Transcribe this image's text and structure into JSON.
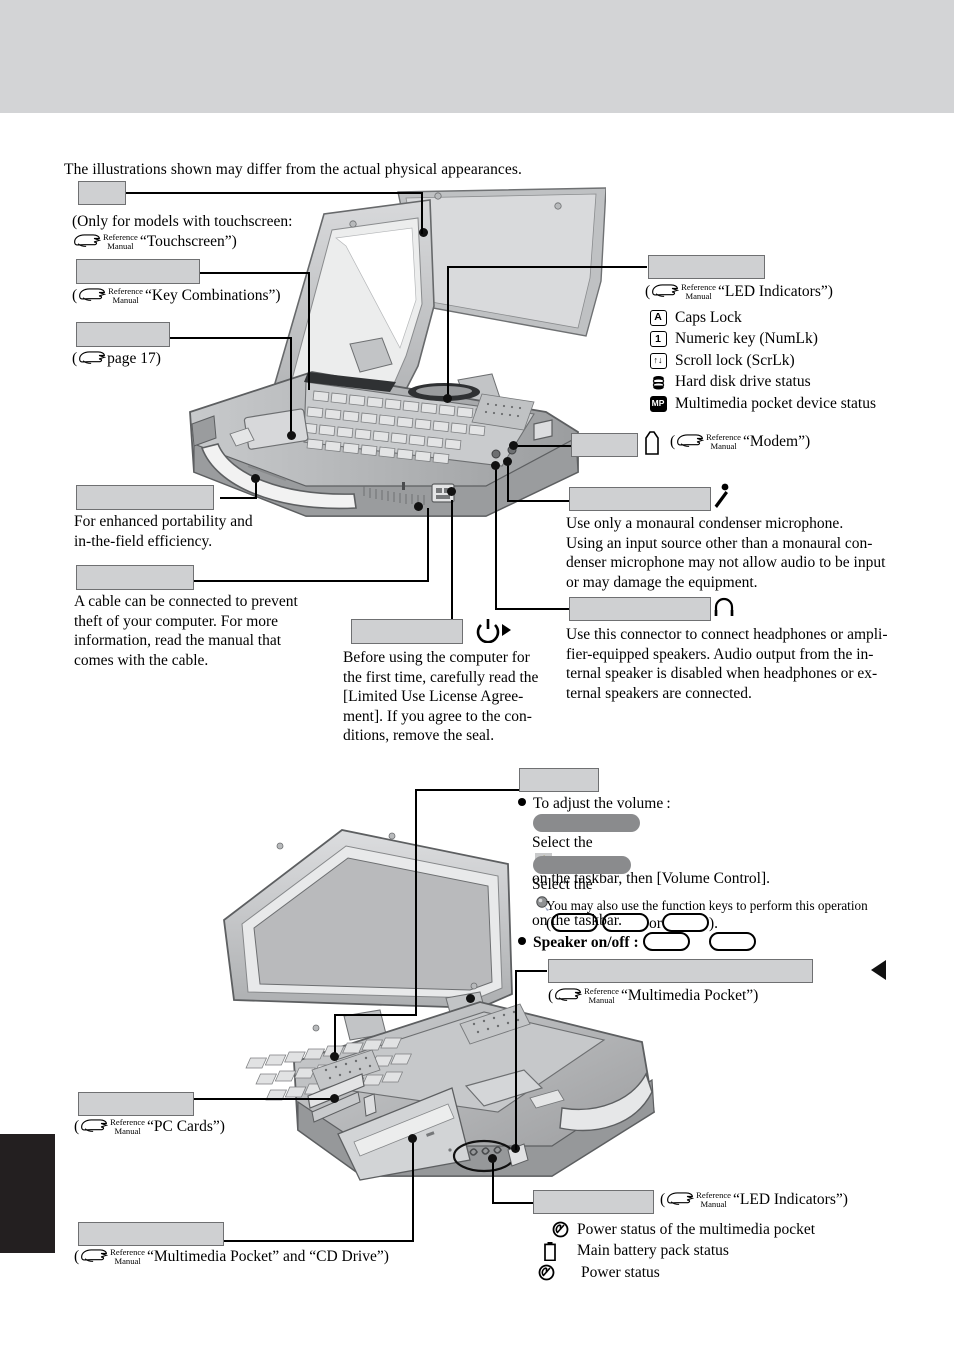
{
  "page": {
    "intro": "The illustrations shown may differ from the actual physical appearances.",
    "reference_manual": {
      "line1": "Reference",
      "line2": "Manual"
    }
  },
  "top_figure": {
    "labels": {
      "touchscreen": {
        "redacted": true,
        "note_line1": "(Only for models with touchscreen:",
        "ref_open": "",
        "ref_target": "“Touchscreen”)"
      },
      "keyboard": {
        "redacted": true,
        "ref_prefix": "(",
        "ref_target": "“Key Combinations”)"
      },
      "touchpad": {
        "redacted": true,
        "ref_prefix": "(",
        "ref_target": "page 17)"
      },
      "handle": {
        "redacted": true,
        "body_line1": "For enhanced portability and",
        "body_line2": "in-the-field efficiency."
      },
      "security_lock": {
        "redacted": true,
        "body_line1": "A cable can be connected to prevent",
        "body_line2": "theft of your computer.  For more",
        "body_line3": "information, read the manual that",
        "body_line4": "comes with the cable."
      },
      "power_switch": {
        "redacted": true,
        "icon": "power-symbol",
        "body_line1": "Before using the computer for",
        "body_line2": "the first time, carefully read the",
        "body_line3": "[Limited Use License Agree-",
        "body_line4": "ment].  If you agree to the con-",
        "body_line5": "ditions, remove the seal."
      },
      "led_indicators": {
        "redacted": true,
        "ref_prefix": "(",
        "ref_target": "“LED Indicators”)",
        "items": [
          {
            "icon": "A",
            "icon_kind": "boxed-letter",
            "label": "Caps Lock"
          },
          {
            "icon": "1",
            "icon_kind": "boxed-letter",
            "label": "Numeric key (NumLk)"
          },
          {
            "icon": "↑↓",
            "icon_kind": "boxed-letter",
            "label": "Scroll lock (ScrLk)"
          },
          {
            "icon": "disk-stack",
            "icon_kind": "glyph",
            "label": "Hard disk drive status"
          },
          {
            "icon": "MP",
            "icon_kind": "boxed-letter",
            "label": "Multimedia pocket device status"
          }
        ]
      },
      "modem_port": {
        "redacted": true,
        "icon": "modem-jack-icon",
        "ref_prefix": "(",
        "ref_target": "“Modem”)"
      },
      "microphone_jack": {
        "redacted": true,
        "icon": "microphone-icon",
        "body_line1": "Use only a monaural condenser microphone.",
        "body_line2": "Using an input source other than a monaural con-",
        "body_line3": "denser microphone may not allow audio to be input",
        "body_line4": "or may damage the equipment."
      },
      "headphone_jack": {
        "redacted": true,
        "icon": "headphone-icon",
        "body_line1": "Use this connector to connect headphones or ampli-",
        "body_line2": "fier-equipped speakers.  Audio output from the in-",
        "body_line3": "ternal speaker is disabled when headphones or ex-",
        "body_line4": "ternal speakers are connected."
      }
    }
  },
  "bottom_figure": {
    "labels": {
      "speaker": {
        "redacted": true,
        "volume_heading": "To adjust the volume :",
        "os_bar_1_redacted": true,
        "volume_line_1": "Select the",
        "volume_line_1_cont": "on the taskbar, then [Volume Control].",
        "os_bar_2_redacted": true,
        "volume_line_2": "Select the",
        "volume_line_2_cont": "on the taskbar.",
        "fnkeys_note": "You may also use the function keys to perform this operation",
        "fnkeys_open": "(",
        "fnkeys_or": "or",
        "fnkeys_close": ").",
        "speaker_onoff": "Speaker on/off :"
      },
      "multimedia_pocket_top": {
        "redacted": true,
        "ref_prefix": "(",
        "ref_target": "“Multimedia Pocket”)"
      },
      "pc_card_slot": {
        "redacted": true,
        "ref_prefix": "(",
        "ref_target": "“PC Cards”)"
      },
      "multimedia_pocket_bottom": {
        "redacted": true,
        "ref_prefix": "(",
        "ref_target": "“Multimedia Pocket” and “CD Drive”)"
      },
      "led_indicators_bottom": {
        "redacted": true,
        "ref_prefix": "(",
        "ref_target": "“LED Indicators”)",
        "items": [
          {
            "icon": "circled-power-icon",
            "label": "Power status of the multimedia pocket"
          },
          {
            "icon": "battery-icon",
            "label": "Main battery pack status"
          },
          {
            "icon": "circled-power-icon",
            "label": "Power status"
          }
        ]
      }
    }
  },
  "colors": {
    "header_band": "#d3d4d6",
    "redaction_light": "#cfd0d2",
    "redaction_dark": "#8a8b8d",
    "tab": "#231f20",
    "volume_icon_yellow": "#e8c020"
  }
}
